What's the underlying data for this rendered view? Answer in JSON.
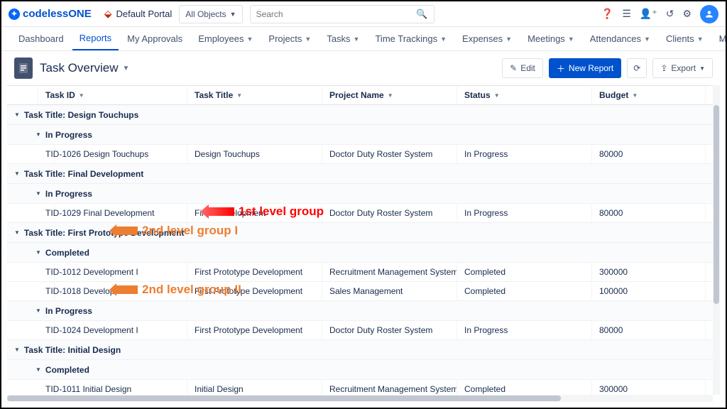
{
  "brand": {
    "text1": "codeless",
    "text2": "ONE"
  },
  "portal": "Default Portal",
  "objects_label": "All Objects",
  "search_placeholder": "Search",
  "tabs": [
    "Dashboard",
    "Reports",
    "My Approvals",
    "Employees",
    "Projects",
    "Tasks",
    "Time Trackings",
    "Expenses",
    "Meetings",
    "Attendances",
    "Clients",
    "Milestones"
  ],
  "active_tab": 1,
  "tabs_with_caret": [
    3,
    4,
    5,
    6,
    7,
    8,
    9,
    10,
    11
  ],
  "page_title": "Task Overview",
  "buttons": {
    "edit": "Edit",
    "new": "New Report",
    "export": "Export"
  },
  "columns": [
    "Task ID",
    "Task Title",
    "Project Name",
    "Status",
    "Budget"
  ],
  "groups": [
    {
      "title": "Task Title: Design Touchups",
      "subs": [
        {
          "title": "In Progress",
          "rows": [
            {
              "id": "TID-1026 Design Touchups",
              "tt": "Design Touchups",
              "pn": "Doctor Duty Roster System",
              "st": "In Progress",
              "bd": "80000"
            }
          ]
        }
      ]
    },
    {
      "title": "Task Title: Final Development",
      "subs": [
        {
          "title": "In Progress",
          "rows": [
            {
              "id": "TID-1029 Final Development",
              "tt": "Final Development",
              "pn": "Doctor Duty Roster System",
              "st": "In Progress",
              "bd": "80000"
            }
          ]
        }
      ]
    },
    {
      "title": "Task Title: First Prototype Development",
      "subs": [
        {
          "title": "Completed",
          "rows": [
            {
              "id": "TID-1012 Development I",
              "tt": "First Prototype Development",
              "pn": "Recruitment Management System",
              "st": "Completed",
              "bd": "300000"
            },
            {
              "id": "TID-1018 Development I",
              "tt": "First Prototype Development",
              "pn": "Sales Management",
              "st": "Completed",
              "bd": "100000"
            }
          ]
        },
        {
          "title": "In Progress",
          "rows": [
            {
              "id": "TID-1024 Development I",
              "tt": "First Prototype Development",
              "pn": "Doctor Duty Roster System",
              "st": "In Progress",
              "bd": "80000"
            }
          ]
        }
      ]
    },
    {
      "title": "Task Title: Initial Design",
      "subs": [
        {
          "title": "Completed",
          "rows": [
            {
              "id": "TID-1011 Initial Design",
              "tt": "Initial Design",
              "pn": "Recruitment Management System",
              "st": "Completed",
              "bd": "300000"
            }
          ]
        }
      ]
    }
  ],
  "annotations": {
    "a1": "1st level group",
    "a2": "2nd level group I",
    "a3": "2nd level group II"
  }
}
